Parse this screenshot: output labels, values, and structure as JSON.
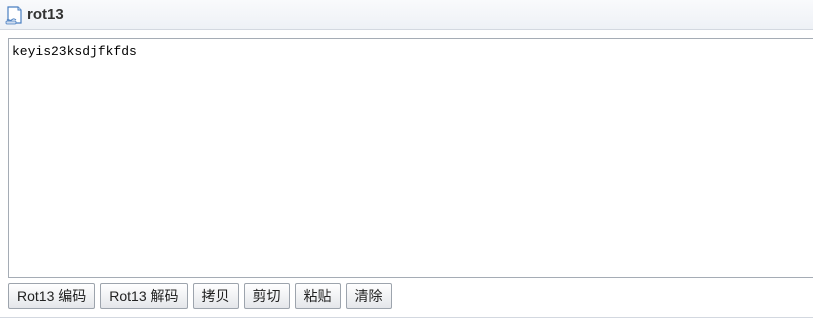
{
  "header": {
    "title": "rot13",
    "icon": "document-icon"
  },
  "editor": {
    "value": "keyis23ksdjfkfds"
  },
  "toolbar": {
    "buttons": [
      {
        "label": "Rot13 编码"
      },
      {
        "label": "Rot13 解码"
      },
      {
        "label": "拷贝"
      },
      {
        "label": "剪切"
      },
      {
        "label": "粘贴"
      },
      {
        "label": "清除"
      }
    ]
  },
  "colors": {
    "header_bg": "#eef1f6",
    "border": "#a5acb5",
    "icon_blue": "#4a7fc1"
  }
}
